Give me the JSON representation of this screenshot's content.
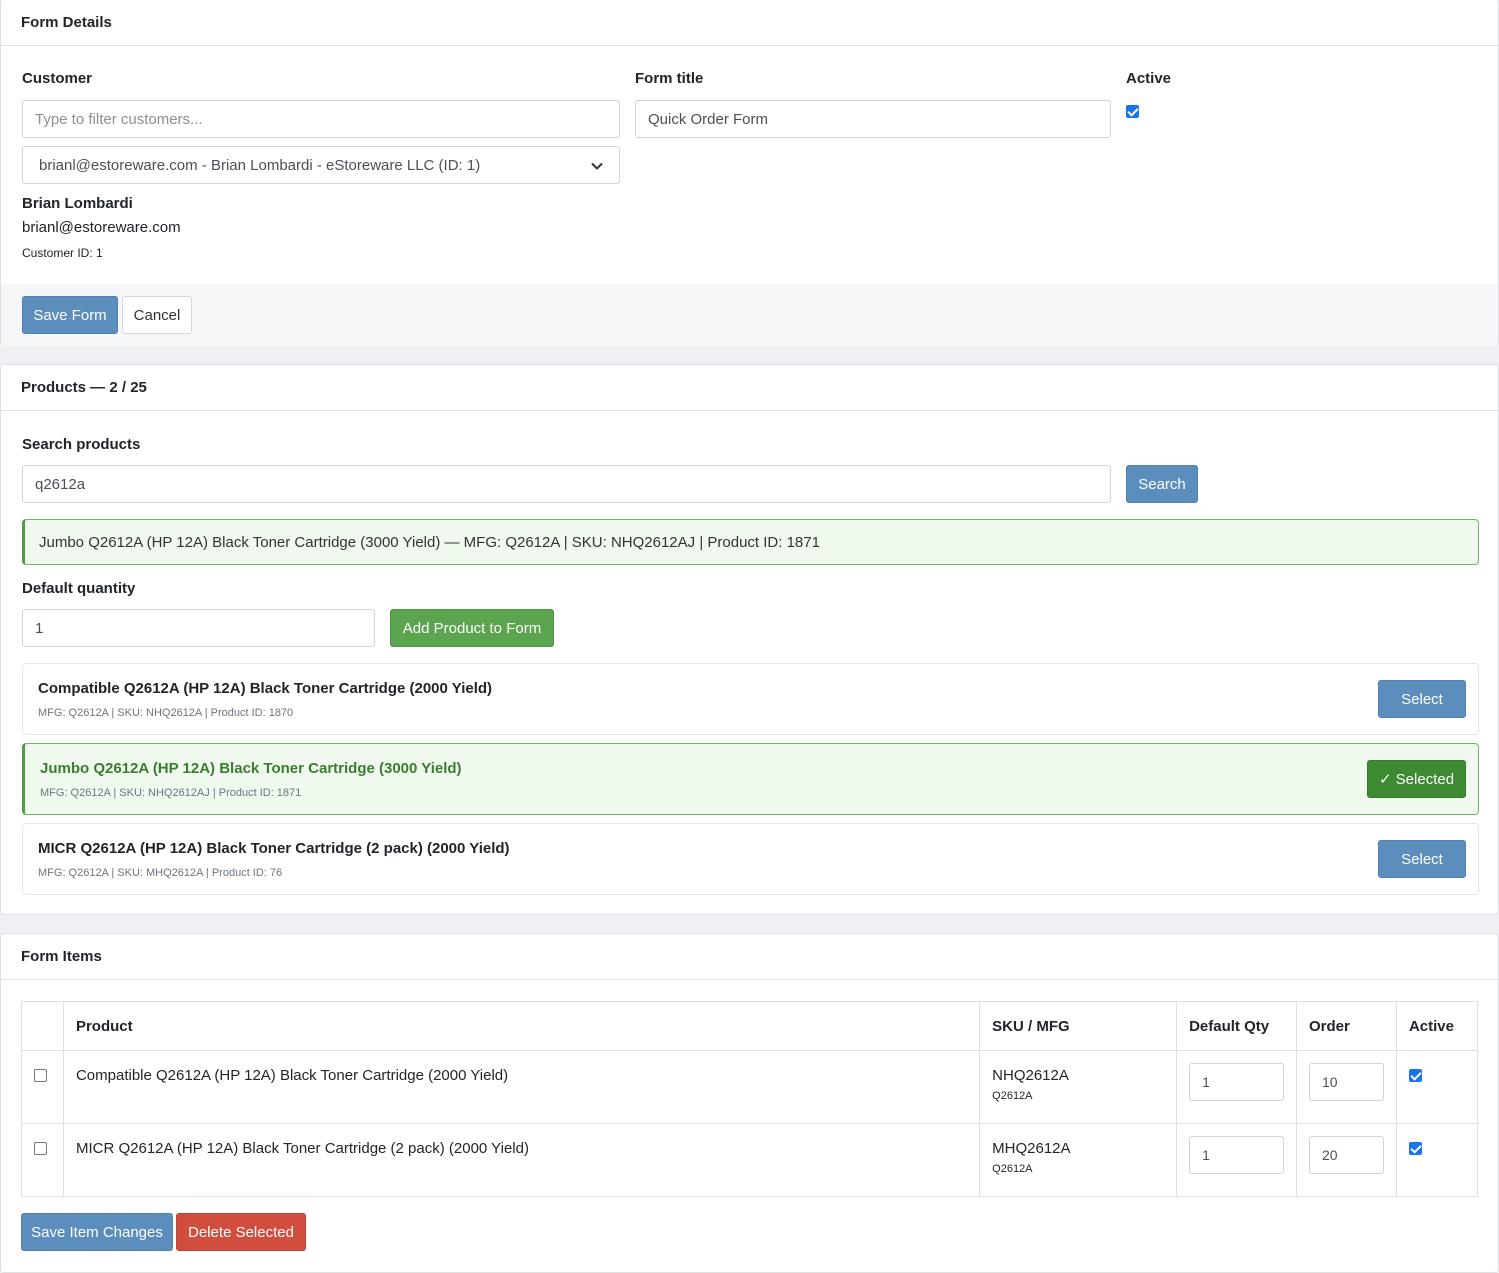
{
  "form_details": {
    "header": "Form Details",
    "customer_label": "Customer",
    "customer_filter_placeholder": "Type to filter customers...",
    "customer_selected": "brianl@estoreware.com - Brian Lombardi - eStoreware LLC (ID: 1)",
    "customer_name": "Brian Lombardi",
    "customer_email": "brianl@estoreware.com",
    "customer_id_text": "Customer ID: 1",
    "form_title_label": "Form title",
    "form_title_value": "Quick Order Form",
    "active_label": "Active",
    "save_label": "Save Form",
    "cancel_label": "Cancel"
  },
  "products": {
    "header": "Products — 2 / 25",
    "search_label": "Search products",
    "search_value": "q2612a",
    "search_button": "Search",
    "selected_summary": "Jumbo Q2612A (HP 12A) Black Toner Cartridge (3000 Yield) — MFG: Q2612A | SKU: NHQ2612AJ | Product ID: 1871",
    "qty_label": "Default quantity",
    "qty_value": "1",
    "add_button": "Add Product to Form",
    "results": [
      {
        "title": "Compatible Q2612A (HP 12A) Black Toner Cartridge (2000 Yield)",
        "meta": "MFG: Q2612A | SKU: NHQ2612A | Product ID: 1870",
        "button": "Select"
      },
      {
        "title": "Jumbo Q2612A (HP 12A) Black Toner Cartridge (3000 Yield)",
        "meta": "MFG: Q2612A | SKU: NHQ2612AJ | Product ID: 1871",
        "button": "✓ Selected"
      },
      {
        "title": "MICR Q2612A (HP 12A) Black Toner Cartridge (2 pack) (2000 Yield)",
        "meta": "MFG: Q2612A | SKU: MHQ2612A | Product ID: 76",
        "button": "Select"
      }
    ]
  },
  "form_items": {
    "header": "Form Items",
    "columns": [
      "",
      "Product",
      "SKU / MFG",
      "Default Qty",
      "Order",
      "Active"
    ],
    "rows": [
      {
        "product": "Compatible Q2612A (HP 12A) Black Toner Cartridge (2000 Yield)",
        "sku": "NHQ2612A",
        "mfg": "Q2612A",
        "qty": "1",
        "order": "10"
      },
      {
        "product": "MICR Q2612A (HP 12A) Black Toner Cartridge (2 pack) (2000 Yield)",
        "sku": "MHQ2612A",
        "mfg": "Q2612A",
        "qty": "1",
        "order": "20"
      }
    ],
    "save_label": "Save Item Changes",
    "delete_label": "Delete Selected"
  }
}
